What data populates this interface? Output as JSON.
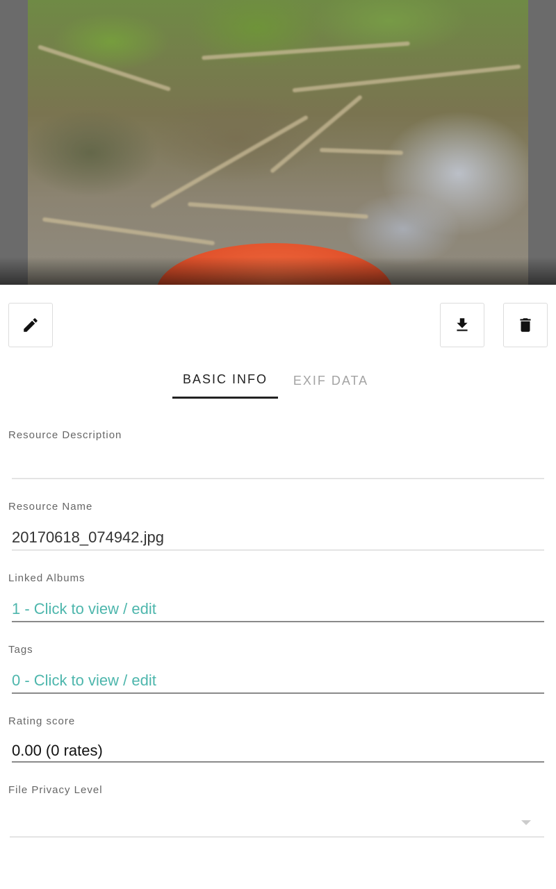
{
  "photo": {
    "alt_name": "resource-photo"
  },
  "actions": {
    "edit_icon": "pencil-icon",
    "download_icon": "download-icon",
    "delete_icon": "trash-icon"
  },
  "tabs": [
    {
      "label": "BASIC INFO",
      "active": true
    },
    {
      "label": "EXIF DATA",
      "active": false
    }
  ],
  "fields": {
    "description": {
      "label": "Resource Description",
      "value": ""
    },
    "name": {
      "label": "Resource Name",
      "value": "20170618_074942.jpg"
    },
    "albums": {
      "label": "Linked Albums",
      "value": "1 - Click to view / edit"
    },
    "tags": {
      "label": "Tags",
      "value": "0 - Click to view / edit"
    },
    "rating": {
      "label": "Rating score",
      "value": "0.00 (0 rates)"
    },
    "privacy": {
      "label": "File Privacy Level",
      "value": ""
    }
  },
  "colors": {
    "accent": "#4db6ac",
    "text": "#333333",
    "tab_inactive": "#a3a3a3"
  }
}
